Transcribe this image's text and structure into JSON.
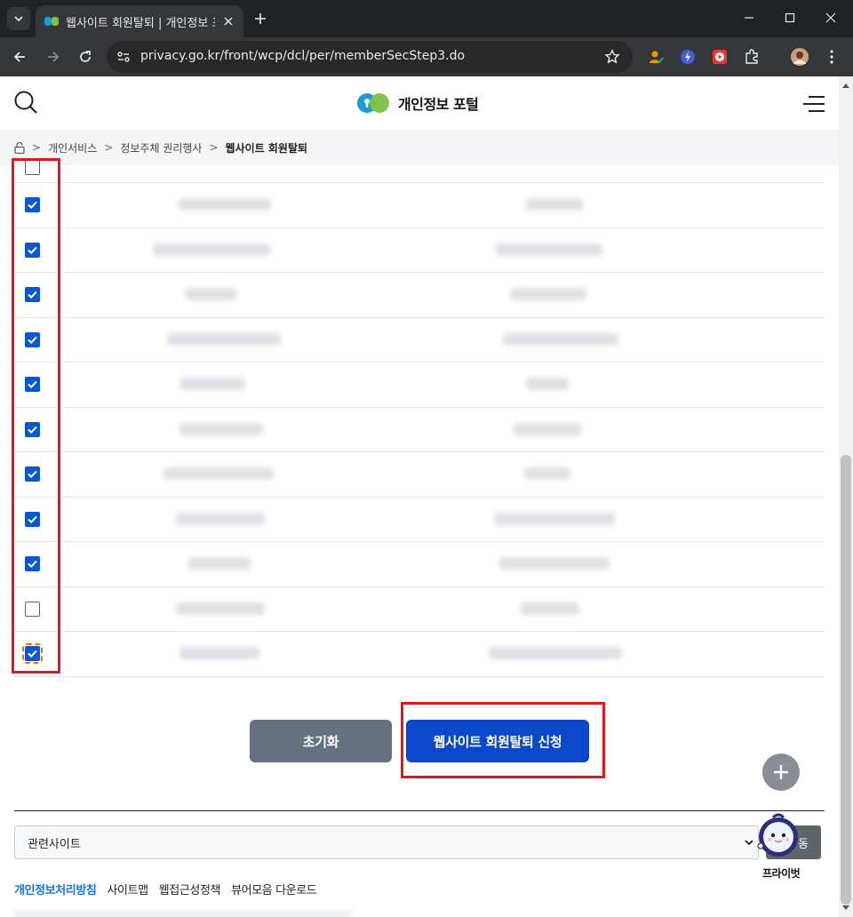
{
  "browser": {
    "tab_title": "웹사이트 회원탈퇴 | 개인정보 포",
    "url": "privacy.go.kr/front/wcp/dcl/per/memberSecStep3.do"
  },
  "header": {
    "logo_text": "개인정보 포털"
  },
  "breadcrumb": {
    "items": [
      "개인서비스",
      "정보주체 권리행사",
      "웹사이트 회원탈퇴"
    ]
  },
  "list": {
    "rows": [
      {
        "checked": true
      },
      {
        "checked": true
      },
      {
        "checked": true
      },
      {
        "checked": true
      },
      {
        "checked": true
      },
      {
        "checked": true
      },
      {
        "checked": true
      },
      {
        "checked": true
      },
      {
        "checked": true
      },
      {
        "checked": false
      },
      {
        "checked": true
      }
    ]
  },
  "actions": {
    "reset_label": "초기화",
    "submit_label": "웹사이트 회원탈퇴 신청"
  },
  "footer": {
    "related_select_value": "관련사이트",
    "go_label": "동",
    "mascot_label": "프라이벗",
    "links": [
      "개인정보처리방침",
      "사이트맵",
      "웹접근성정책",
      "뷰어모음 다운로드"
    ]
  },
  "colors": {
    "brand_blue": "#0b47c9",
    "checkbox_blue": "#0b57d0",
    "highlight_red": "#e3171d"
  }
}
